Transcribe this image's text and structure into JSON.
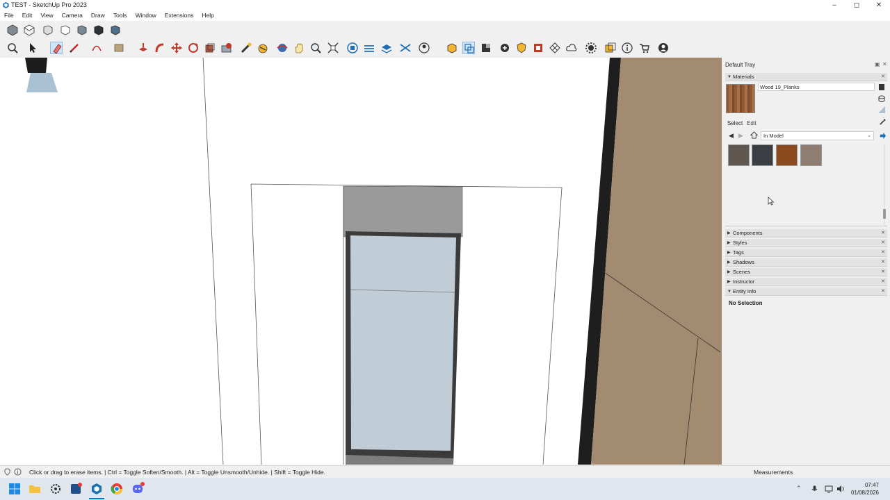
{
  "window": {
    "title": "TEST - SketchUp Pro 2023"
  },
  "menu": [
    "File",
    "Edit",
    "View",
    "Camera",
    "Draw",
    "Tools",
    "Window",
    "Extensions",
    "Help"
  ],
  "tray": {
    "title": "Default Tray",
    "materials": {
      "header": "Materials",
      "current_material": "Wood 19_Planks",
      "tabs": [
        "Select",
        "Edit"
      ],
      "collection": "In Model",
      "swatch_colors": [
        "#5f574f",
        "#3b3f43",
        "#8a4a1e",
        "#8e7d70"
      ]
    },
    "panels": [
      "Components",
      "Styles",
      "Tags",
      "Shadows",
      "Scenes",
      "Instructor",
      "Entity Info"
    ],
    "entity_info": {
      "text": "No Selection"
    }
  },
  "status": {
    "hint": "Click or drag to erase items. | Ctrl = Toggle Soften/Smooth. | Alt = Toggle Unsmooth/Unhide. | Shift = Toggle Hide.",
    "measurements_label": "Measurements"
  },
  "taskbar": {
    "time": "07:47",
    "date": "01/08/2026"
  },
  "colors": {
    "accent": "#0078d4",
    "wood": "#a38b71",
    "glass": "#c0ccd6"
  }
}
